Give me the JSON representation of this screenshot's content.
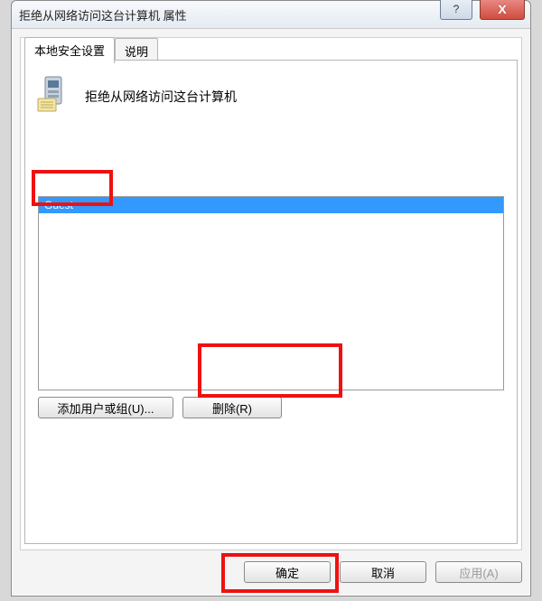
{
  "window": {
    "title": "拒绝从网络访问这台计算机 属性",
    "help_hint": "?",
    "close_hint": "X"
  },
  "tabs": {
    "local_security": "本地安全设置",
    "explain": "说明"
  },
  "policy": {
    "title": "拒绝从网络访问这台计算机"
  },
  "list": {
    "items": [
      {
        "name": "Guest",
        "selected": true
      }
    ]
  },
  "buttons": {
    "add": "添加用户或组(U)...",
    "remove": "删除(R)",
    "ok": "确定",
    "cancel": "取消",
    "apply": "应用(A)"
  }
}
